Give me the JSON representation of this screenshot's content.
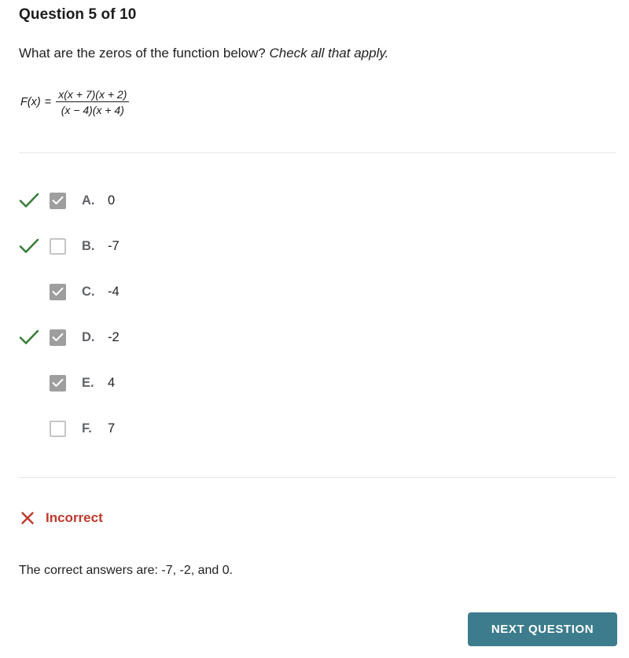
{
  "header": {
    "title": "Question 5 of 10"
  },
  "prompt": {
    "text": "What are the zeros of the function below?",
    "emphasis": "Check all that apply."
  },
  "formula": {
    "function_name": "F(x)",
    "equals": "=",
    "numerator": "x(x + 7)(x + 2)",
    "denominator": "(x − 4)(x + 4)",
    "plain": "F(x) = x(x + 7)(x + 2) / ((x − 4)(x + 4))"
  },
  "options": [
    {
      "letter": "A.",
      "value": "0",
      "checked": true,
      "marked_correct": true
    },
    {
      "letter": "B.",
      "value": "-7",
      "checked": false,
      "marked_correct": true
    },
    {
      "letter": "C.",
      "value": "-4",
      "checked": true,
      "marked_correct": false
    },
    {
      "letter": "D.",
      "value": "-2",
      "checked": true,
      "marked_correct": true
    },
    {
      "letter": "E.",
      "value": "4",
      "checked": true,
      "marked_correct": false
    },
    {
      "letter": "F.",
      "value": "7",
      "checked": false,
      "marked_correct": false
    }
  ],
  "feedback": {
    "icon": "x-mark-icon",
    "status": "Incorrect",
    "explanation": "The correct answers are: -7, -2, and 0."
  },
  "footer": {
    "next_label": "NEXT QUESTION"
  },
  "colors": {
    "correct_green": "#3a7d3a",
    "incorrect_red": "#c0392b",
    "checkbox_checked_gray": "#9e9e9e",
    "checkbox_border_gray": "#c6c6c6",
    "button_teal": "#3c7c8c",
    "divider_gray": "#e4e4e4",
    "letter_gray": "#5f6368",
    "text_dark": "#202124"
  }
}
